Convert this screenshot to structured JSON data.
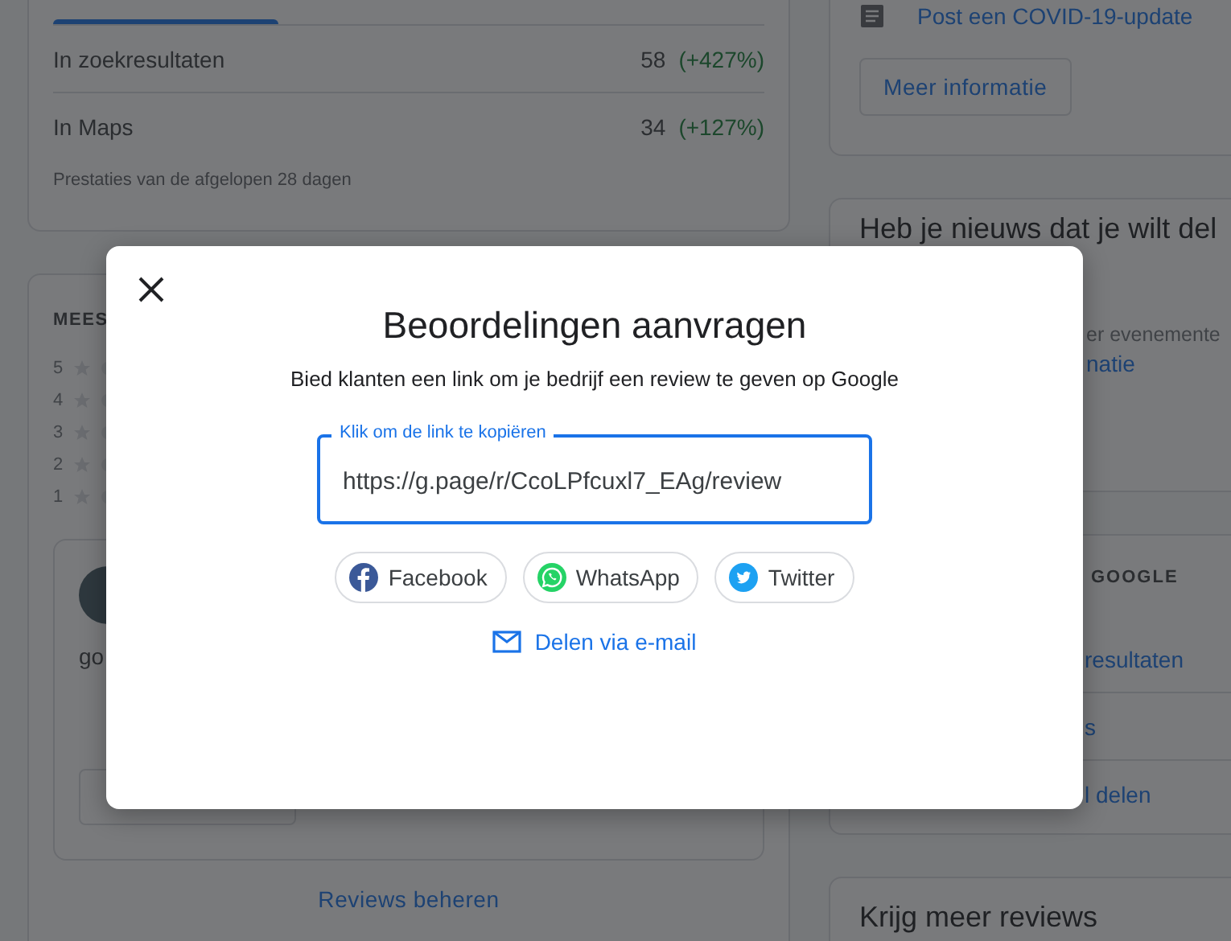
{
  "performance_card": {
    "rows": [
      {
        "label": "In zoekresultaten",
        "value": "58",
        "change": "(+427%)"
      },
      {
        "label": "In Maps",
        "value": "34",
        "change": "(+127%)"
      }
    ],
    "footnote": "Prestaties van de afgelopen 28 dagen"
  },
  "reviews_card": {
    "heading": "MEES",
    "rating_rows": [
      {
        "label": "5"
      },
      {
        "label": "4"
      },
      {
        "label": "3"
      },
      {
        "label": "2"
      },
      {
        "label": "1"
      }
    ],
    "review": {
      "text": "go"
    },
    "manage_link": "Reviews beheren"
  },
  "covid_card": {
    "link": "Post een COVID-19-update",
    "button": "Meer informatie"
  },
  "news_card": {
    "title": "Heb je nieuws dat je wilt del",
    "text": "er evenemente",
    "link": "natie"
  },
  "google_card": {
    "heading": "GOOGLE",
    "links": [
      "resultaten",
      "s",
      "l delen"
    ]
  },
  "reviews_prompt_card": {
    "title": "Krijg meer reviews"
  },
  "dialog": {
    "title": "Beoordelingen aanvragen",
    "subtitle": "Bied klanten een link om je bedrijf een review te geven op Google",
    "link_field": {
      "label": "Klik om de link te kopiëren",
      "value": "https://g.page/r/CcoLPfcuxl7_EAg/review"
    },
    "share_buttons": [
      {
        "kind": "facebook",
        "label": "Facebook"
      },
      {
        "kind": "whatsapp",
        "label": "WhatsApp"
      },
      {
        "kind": "twitter",
        "label": "Twitter"
      }
    ],
    "email_link": "Delen via e-mail"
  }
}
